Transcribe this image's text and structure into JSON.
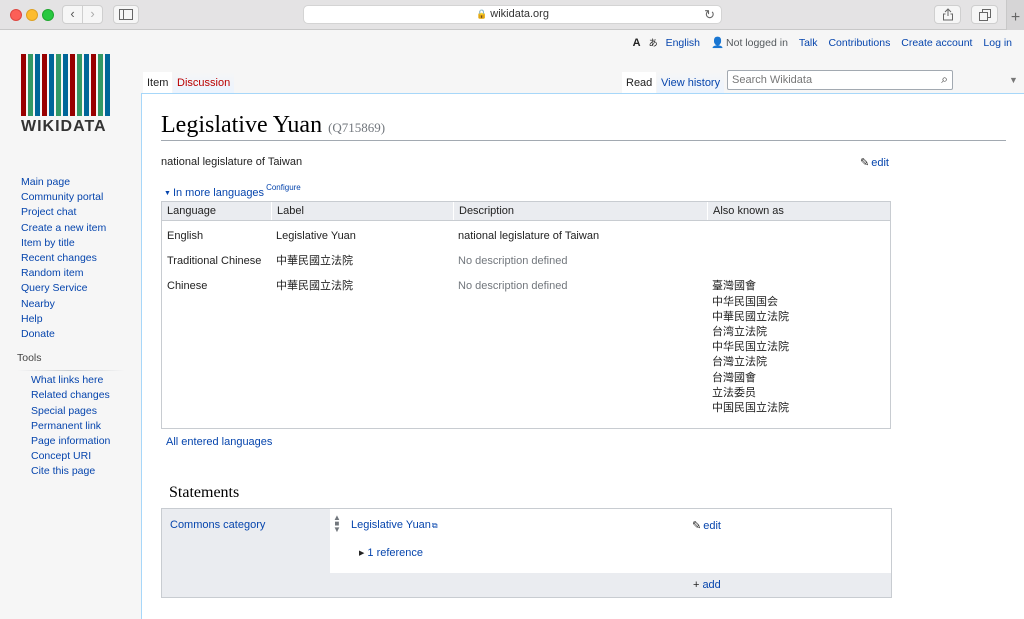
{
  "browser": {
    "url": "wikidata.org"
  },
  "logo": {
    "text": "WIKIDATA",
    "bar_colors": [
      "#990000",
      "#339966",
      "#006699",
      "#990000",
      "#006699",
      "#339966",
      "#006699",
      "#990000",
      "#339966",
      "#006699",
      "#990000",
      "#339966",
      "#006699"
    ]
  },
  "personal": {
    "language": "English",
    "status": "Not logged in",
    "talk": "Talk",
    "contributions": "Contributions",
    "create_account": "Create account",
    "log_in": "Log in"
  },
  "tabs": {
    "item": "Item",
    "discussion": "Discussion",
    "read": "Read",
    "view_history": "View history"
  },
  "search": {
    "placeholder": "Search Wikidata"
  },
  "sidebar": {
    "nav": [
      "Main page",
      "Community portal",
      "Project chat",
      "Create a new item",
      "Item by title",
      "Recent changes",
      "Random item",
      "Query Service",
      "Nearby",
      "Help",
      "Donate"
    ],
    "tools_heading": "Tools",
    "tools": [
      "What links here",
      "Related changes",
      "Special pages",
      "Permanent link",
      "Page information",
      "Concept URI",
      "Cite this page"
    ]
  },
  "item": {
    "title": "Legislative Yuan",
    "qid": "(Q715869)",
    "description": "national legislature of Taiwan",
    "edit": "edit"
  },
  "languages": {
    "toggle": "In more languages",
    "configure": "Configure",
    "headers": [
      "Language",
      "Label",
      "Description",
      "Also known as"
    ],
    "rows": [
      {
        "language": "English",
        "label": "Legislative Yuan",
        "description": "national legislature of Taiwan",
        "aliases": ""
      },
      {
        "language": "Traditional Chinese",
        "label": "中華民國立法院",
        "description": "No description defined",
        "aliases": ""
      },
      {
        "language": "Chinese",
        "label": "中華民國立法院",
        "description": "No description defined",
        "aliases": ""
      }
    ],
    "chinese_aliases": [
      "臺灣國會",
      "中华民国国会",
      "中華民國立法院",
      "台湾立法院",
      "中华民国立法院",
      "台灣立法院",
      "台灣國會",
      "立法委员",
      "中国民国立法院"
    ],
    "all_languages": "All entered languages"
  },
  "statements": {
    "heading": "Statements",
    "property": "Commons category",
    "value": "Legislative Yuan",
    "edit": "edit",
    "references": "1 reference",
    "add": "add"
  }
}
